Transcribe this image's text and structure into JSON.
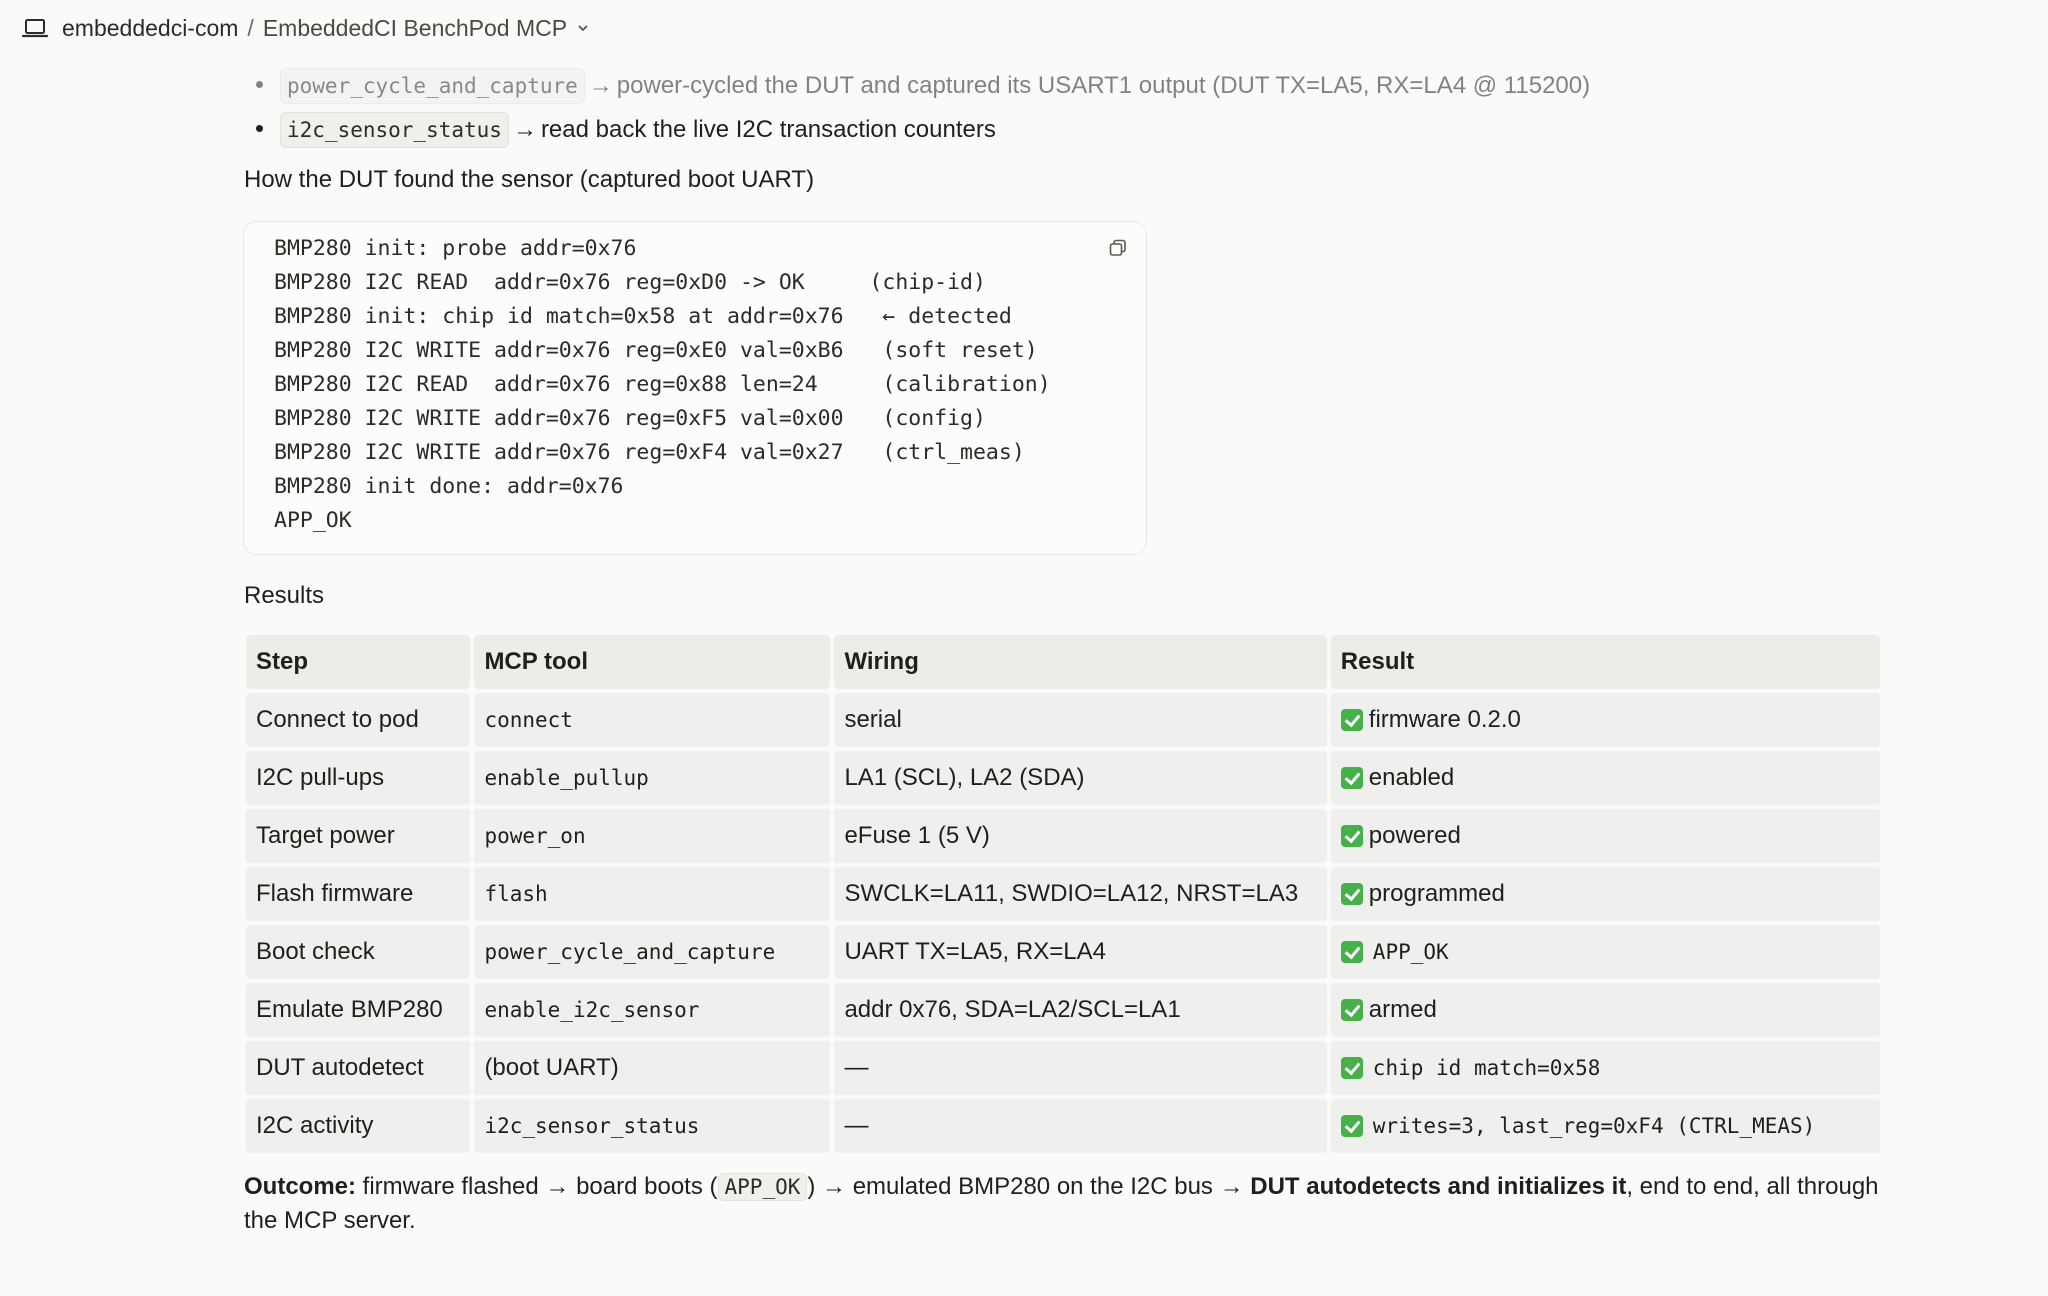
{
  "header": {
    "org": "embeddedci-com",
    "separator": "/",
    "project": "EmbeddedCI BenchPod MCP"
  },
  "bullets": [
    {
      "code": "power_cycle_and_capture",
      "arrow": "→",
      "text": "power-cycled the DUT and captured its USART1 output (DUT TX=LA5, RX=LA4 @ 115200)"
    },
    {
      "code": "i2c_sensor_status",
      "arrow": "→",
      "text": "read back the live I2C transaction counters"
    }
  ],
  "sections": {
    "boot_heading": "How the DUT found the sensor (captured boot UART)",
    "results_heading": "Results"
  },
  "code_block": {
    "lines": [
      "BMP280 init: probe addr=0x76",
      "BMP280 I2C READ  addr=0x76 reg=0xD0 -> OK     (chip-id)",
      "BMP280 init: chip id match=0x58 at addr=0x76   ← detected",
      "BMP280 I2C WRITE addr=0x76 reg=0xE0 val=0xB6   (soft reset)",
      "BMP280 I2C READ  addr=0x76 reg=0x88 len=24     (calibration)",
      "BMP280 I2C WRITE addr=0x76 reg=0xF5 val=0x00   (config)",
      "BMP280 I2C WRITE addr=0x76 reg=0xF4 val=0x27   (ctrl_meas)",
      "BMP280 init done: addr=0x76",
      "APP_OK"
    ]
  },
  "table": {
    "headers": [
      "Step",
      "MCP tool",
      "Wiring",
      "Result"
    ],
    "rows": [
      {
        "step": "Connect to pod",
        "tool": "connect",
        "wiring": "serial",
        "result": "firmware 0.2.0"
      },
      {
        "step": "I2C pull-ups",
        "tool": "enable_pullup",
        "wiring": "LA1 (SCL), LA2 (SDA)",
        "result": "enabled"
      },
      {
        "step": "Target power",
        "tool": "power_on",
        "wiring": "eFuse 1 (5 V)",
        "result": "powered"
      },
      {
        "step": "Flash firmware",
        "tool": "flash",
        "wiring": "SWCLK=LA11, SWDIO=LA12, NRST=LA3",
        "result": "programmed"
      },
      {
        "step": "Boot check",
        "tool": "power_cycle_and_capture",
        "wiring": "UART TX=LA5, RX=LA4",
        "result": "APP_OK"
      },
      {
        "step": "Emulate BMP280",
        "tool": "enable_i2c_sensor",
        "wiring": "addr 0x76, SDA=LA2/SCL=LA1",
        "result": "armed"
      },
      {
        "step": "DUT autodetect",
        "tool": "(boot UART)",
        "wiring": "—",
        "result": "chip id match=0x58"
      },
      {
        "step": "I2C activity",
        "tool": "i2c_sensor_status",
        "wiring": "—",
        "result": "writes=3, last_reg=0xF4 (CTRL_MEAS)"
      }
    ]
  },
  "outcome": {
    "label": "Outcome:",
    "part1": " firmware flashed → board boots (",
    "code": "APP_OK",
    "part2": ") → emulated BMP280 on the I2C bus → ",
    "bold": "DUT autodetects and initializes it",
    "part3": ", end to end, all through the MCP server."
  },
  "colors": {
    "check": "#48b04a",
    "background": "#fafaf9",
    "cell": "#efefed"
  }
}
